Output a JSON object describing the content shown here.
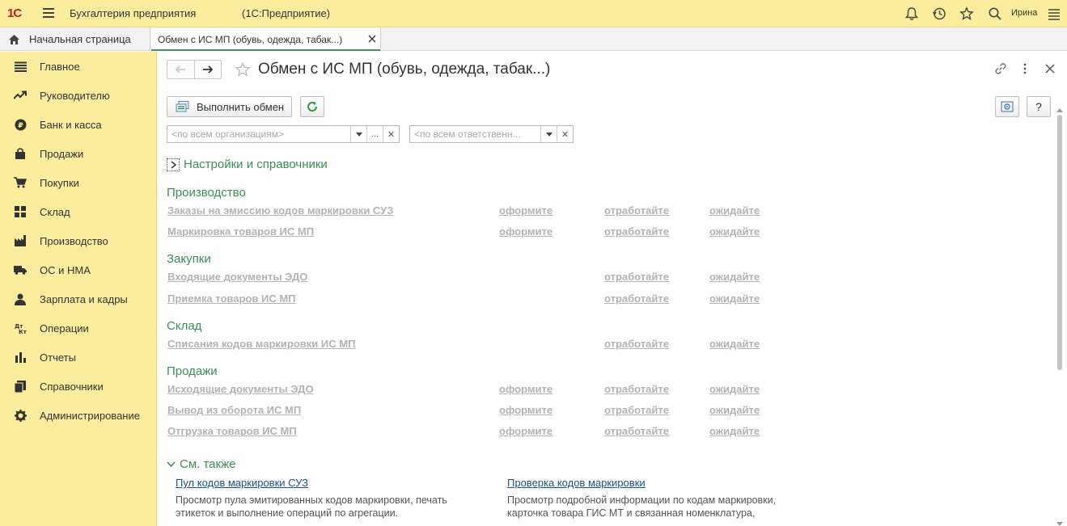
{
  "topbar": {
    "logo": "1С",
    "app_title": "Бухгалтерия предприятия",
    "app_subtitle": "(1С:Предприятие)",
    "user": "Ирина"
  },
  "tabs": {
    "home_label": "Начальная страница",
    "active_label": "Обмен с ИС МП (обувь, одежда, табак...)"
  },
  "sidebar": {
    "items": [
      {
        "label": "Главное",
        "icon": "list-icon"
      },
      {
        "label": "Руководителю",
        "icon": "trend-icon"
      },
      {
        "label": "Банк и касса",
        "icon": "coin-icon"
      },
      {
        "label": "Продажи",
        "icon": "bag-icon"
      },
      {
        "label": "Покупки",
        "icon": "cart-icon"
      },
      {
        "label": "Склад",
        "icon": "grid-icon"
      },
      {
        "label": "Производство",
        "icon": "factory-icon"
      },
      {
        "label": "ОС и НМА",
        "icon": "truck-icon"
      },
      {
        "label": "Зарплата и кадры",
        "icon": "person-icon"
      },
      {
        "label": "Операции",
        "icon": "dtkt-icon"
      },
      {
        "label": "Отчеты",
        "icon": "bar-chart-icon"
      },
      {
        "label": "Справочники",
        "icon": "books-icon"
      },
      {
        "label": "Администрирование",
        "icon": "gear-icon"
      }
    ]
  },
  "form": {
    "title": "Обмен с ИС МП (обувь, одежда, табак...)",
    "exec_button": "Выполнить обмен",
    "help_button": "?",
    "org_placeholder": "<по всем организациям>",
    "resp_placeholder": "<по всем ответственн...",
    "settings_section": "Настройки и справочники",
    "groups": [
      {
        "title": "Производство",
        "rows": [
          {
            "label": "Заказы на эмиссию кодов маркировки СУЗ",
            "a1": "оформите",
            "a2": "отработайте",
            "a3": "ожидайте"
          },
          {
            "label": "Маркировка товаров ИС МП",
            "a1": "оформите",
            "a2": "отработайте",
            "a3": "ожидайте"
          }
        ]
      },
      {
        "title": "Закупки",
        "rows": [
          {
            "label": "Входящие документы ЭДО",
            "a1": "",
            "a2": "отработайте",
            "a3": "ожидайте"
          },
          {
            "label": "Приемка товаров ИС МП",
            "a1": "",
            "a2": "отработайте",
            "a3": "ожидайте"
          }
        ]
      },
      {
        "title": "Склад",
        "rows": [
          {
            "label": "Списания кодов маркировки ИС МП",
            "a1": "",
            "a2": "отработайте",
            "a3": "ожидайте"
          }
        ]
      },
      {
        "title": "Продажи",
        "rows": [
          {
            "label": "Исходящие документы ЭДО",
            "a1": "оформите",
            "a2": "отработайте",
            "a3": "ожидайте"
          },
          {
            "label": "Вывод из оборота ИС МП",
            "a1": "оформите",
            "a2": "отработайте",
            "a3": "ожидайте"
          },
          {
            "label": "Отгрузка товаров ИС МП",
            "a1": "оформите",
            "a2": "отработайте",
            "a3": "ожидайте"
          }
        ]
      }
    ],
    "see_also": {
      "title": "См. также",
      "left_link": "Пул кодов маркировки СУЗ",
      "left_desc": "Просмотр пула эмитированных кодов маркировки, печать этикеток и выполнение операций по агрегации.",
      "right_link": "Проверка кодов маркировки",
      "right_desc": "Просмотр подробной информации по кодам маркировки, карточка товара ГИС МТ и связанная номенклатура,"
    }
  },
  "colors": {
    "panel_yellow": "#fbed9e",
    "section_green": "#3b8f55",
    "disabled_link": "#b3b3b3",
    "link_blue": "#1f4f8f"
  }
}
